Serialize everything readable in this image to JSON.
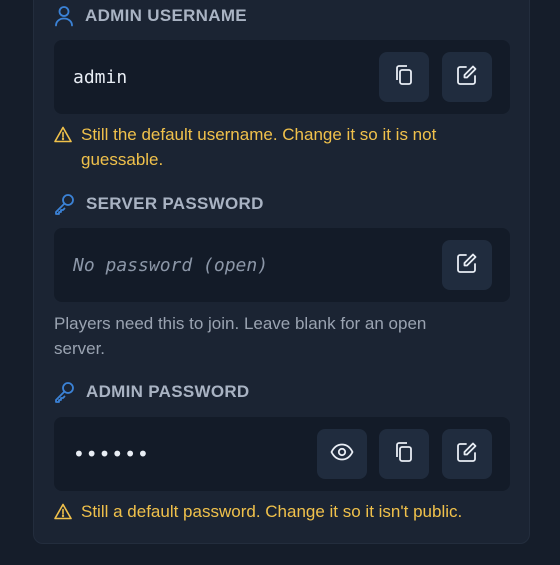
{
  "colors": {
    "background": "#151d2a",
    "card": "#1b2433",
    "field": "#131b28",
    "button": "#202c3e",
    "accent_blue": "#3b82d6",
    "warning": "#f0c14b"
  },
  "admin_username": {
    "icon": "user-icon",
    "label": "ADMIN USERNAME",
    "value": "admin",
    "buttons": [
      "copy-icon",
      "edit-icon"
    ],
    "warning": "Still the default username. Change it so it is not guessable."
  },
  "server_password": {
    "icon": "key-icon",
    "label": "SERVER PASSWORD",
    "placeholder": "No password (open)",
    "buttons": [
      "edit-icon"
    ],
    "hint": "Players need this to join. Leave blank for an open server."
  },
  "admin_password": {
    "icon": "key-icon",
    "label": "ADMIN PASSWORD",
    "masked_value": "••••••",
    "buttons": [
      "eye-icon",
      "copy-icon",
      "edit-icon"
    ],
    "warning": "Still a default password. Change it so it isn't public."
  }
}
